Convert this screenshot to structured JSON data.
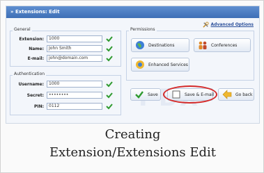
{
  "window": {
    "title": "» Extensions: Edit"
  },
  "links": {
    "advanced_options": "Advanced Options"
  },
  "general": {
    "legend": "General",
    "extension_label": "Extension:",
    "extension_value": "1000",
    "name_label": "Name:",
    "name_value": "John Smith",
    "email_label": "E-mail:",
    "email_value": "john@domain.com"
  },
  "authentication": {
    "legend": "Authentication",
    "username_label": "Username:",
    "username_value": "1000",
    "secret_label": "Secret:",
    "secret_value": "••••••••",
    "pin_label": "PIN:",
    "pin_value": "0112"
  },
  "permissions": {
    "legend": "Permissions",
    "destinations": "Destinations",
    "conferences": "Conferences",
    "enhanced_services": "Enhanced Services"
  },
  "actions": {
    "save": "Save",
    "save_email": "Save & E-mail",
    "go_back": "Go back"
  },
  "watermark": "PBX",
  "caption": {
    "line1": "Creating",
    "line2": "Extension/Extensions Edit"
  },
  "colors": {
    "title_bar": "#4a7bc2",
    "ok_check": "#2f9a2f",
    "highlight_ring": "#d42a2a"
  }
}
